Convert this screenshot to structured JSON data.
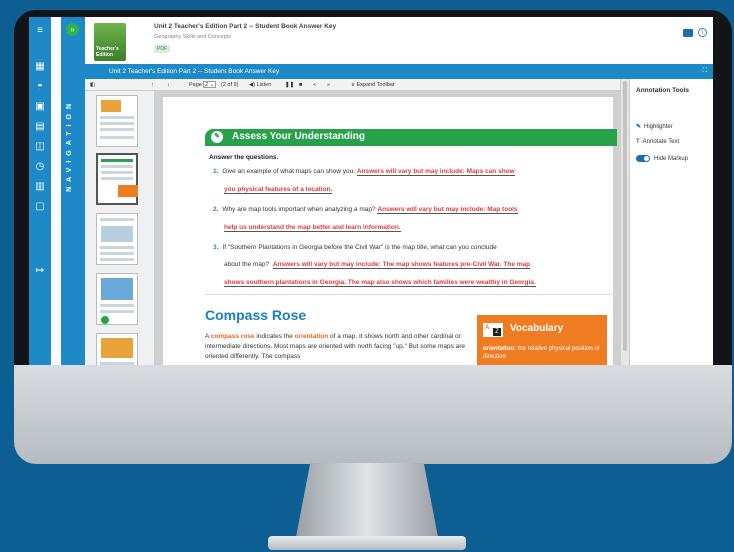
{
  "header": {
    "title": "Unit 2 Teacher's Edition Part 2 -- Student Book Answer Key",
    "subtitle": "Geography Skills and Concepts",
    "badge": "PDF",
    "cover_text": "Teacher's Edition"
  },
  "nav": {
    "label": "NAVIGATION",
    "toggle_glyph": "»"
  },
  "doc_bar": {
    "title": "Unit 2 Teacher's Edition Part 2 -- Student Book Answer Key",
    "expand_glyph": "⛶"
  },
  "toolbar": {
    "page_label": "Page",
    "page_value": "2",
    "page_count": "(2 of 9)",
    "listen_label": "Listen",
    "expand_label": "Expand Toolbar"
  },
  "assess": {
    "title": "Assess Your Understanding",
    "intro": "Answer the questions.",
    "q1_num": "1.",
    "q1_text": "Give an example of what maps can show you.",
    "q1_ans_a": "Answers will vary but may include:  Maps can show",
    "q1_ans_b": "you physical features of a location.",
    "q2_num": "2.",
    "q2_text": "Why are map tools important when analyzing a map?",
    "q2_ans_a": "Answers will vary but may include:  Map tools",
    "q2_ans_b": "help us understand the map better and learn information.",
    "q3_num": "3.",
    "q3_text": "If \"Southern Plantations in Georgia before the Civil War\" is the map title, what can you conclude",
    "q3_text_b": "about the map?",
    "q3_ans_a": "Answers will vary but may include:  The map shows features pre-Civil War.  The map",
    "q3_ans_b": "shows southern plantations in Georgia.  The map also shows which families were wealthy in Georgia."
  },
  "compass": {
    "title": "Compass Rose",
    "p_pre": "A",
    "p_term1": "compass rose",
    "p_mid": "indicates the",
    "p_term2": "orientation",
    "p_post": "of a map.  It shows north and other cardinal or intermediate directions.  Most maps are oriented with north facing \"up.\"  But some maps are oriented differently.  The compass"
  },
  "vocab": {
    "title": "Vocabulary",
    "icon_a": "A",
    "icon_z": "Z",
    "term": "orientation:",
    "definition": "the relative physical position or direction"
  },
  "annotation": {
    "title": "Annotation Tools",
    "highlighter": "Highlighter",
    "annotate_text": "Annotate Text",
    "hide_markup": "Hide Markup"
  },
  "colors": {
    "brand_blue": "#1d8ac7",
    "assess_green": "#27a24b",
    "answer_red": "#e03a3a",
    "vocab_orange": "#f07c22"
  }
}
